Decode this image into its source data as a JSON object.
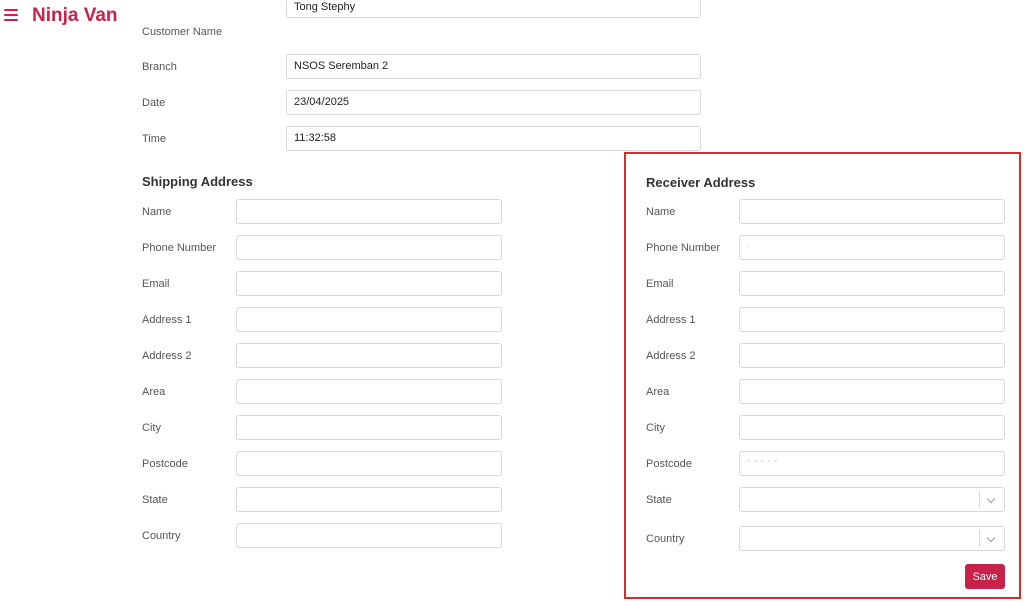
{
  "header": {
    "brand": "Ninja Van",
    "menu_icon": "hamburger-menu-icon"
  },
  "order_info": {
    "customer_name_label": "Customer Name",
    "customer_name_value": "Tong Stephy",
    "branch_label": "Branch",
    "branch_value": "NSOS Seremban 2",
    "date_label": "Date",
    "date_value": "23/04/2025",
    "time_label": "Time",
    "time_value": "11:32:58"
  },
  "shipping": {
    "title": "Shipping Address",
    "fields": {
      "name": {
        "label": "Name",
        "value": ""
      },
      "phone": {
        "label": "Phone Number",
        "value": ""
      },
      "email": {
        "label": "Email",
        "value": ""
      },
      "address1": {
        "label": "Address 1",
        "value": ""
      },
      "address2": {
        "label": "Address 2",
        "value": ""
      },
      "area": {
        "label": "Area",
        "value": ""
      },
      "city": {
        "label": "City",
        "value": ""
      },
      "postcode": {
        "label": "Postcode",
        "value": ""
      },
      "state": {
        "label": "State",
        "value": ""
      },
      "country": {
        "label": "Country",
        "value": ""
      }
    }
  },
  "receiver": {
    "title": "Receiver Address",
    "fields": {
      "name": {
        "label": "Name",
        "value": ""
      },
      "phone": {
        "label": "Phone Number",
        "value": "·"
      },
      "email": {
        "label": "Email",
        "value": ""
      },
      "address1": {
        "label": "Address 1",
        "value": ""
      },
      "address2": {
        "label": "Address 2",
        "value": ""
      },
      "area": {
        "label": "Area",
        "value": ""
      },
      "city": {
        "label": "City",
        "value": ""
      },
      "postcode": {
        "label": "Postcode",
        "value": "- - - - -"
      },
      "state": {
        "label": "State",
        "value": ""
      },
      "country": {
        "label": "Country",
        "value": ""
      }
    },
    "save_label": "Save"
  },
  "colors": {
    "brand": "#c8214a",
    "highlight_border": "#d32f2f"
  }
}
